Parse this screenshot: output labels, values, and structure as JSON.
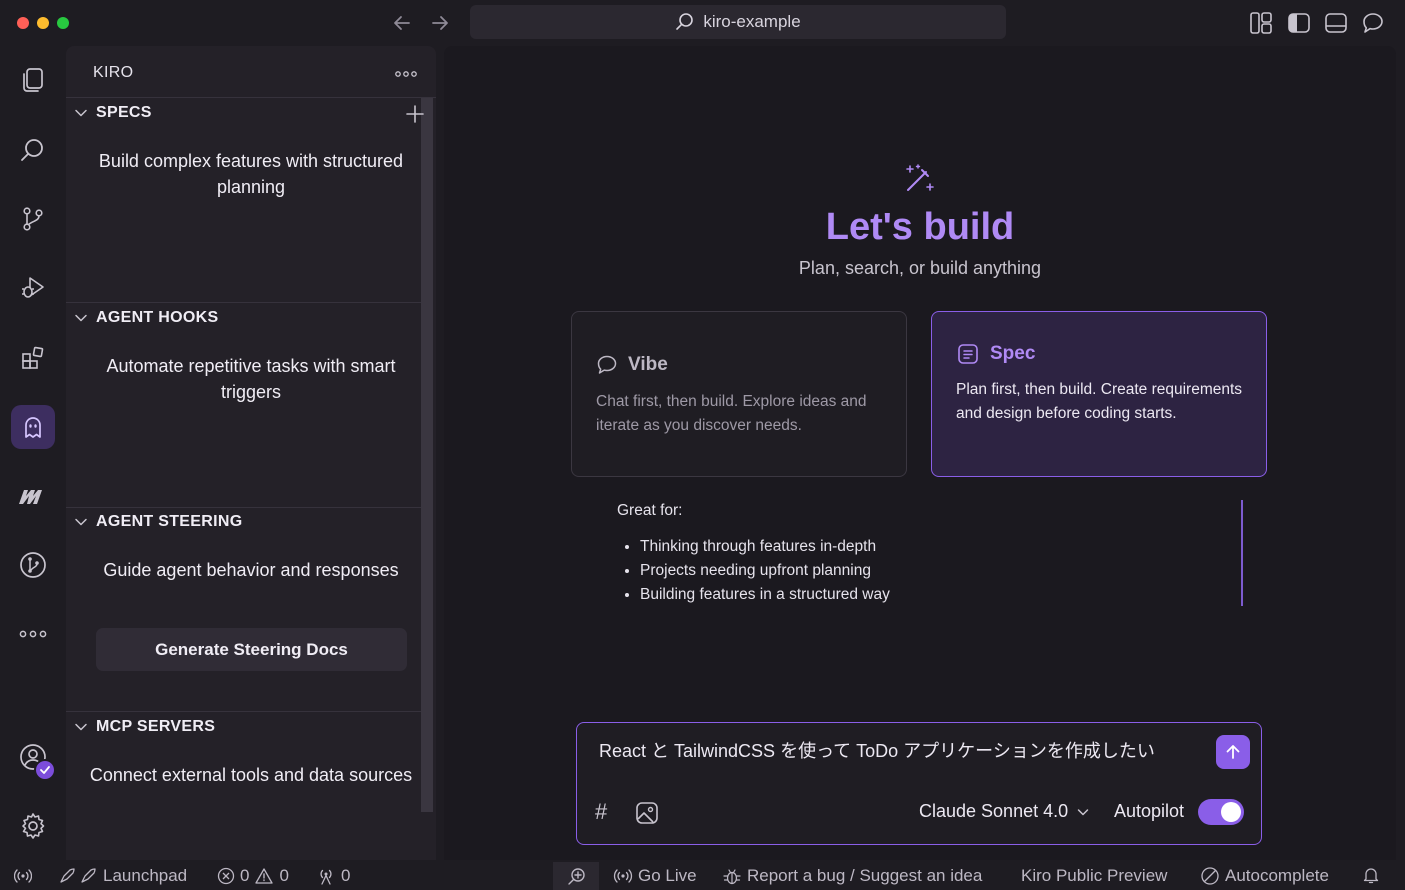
{
  "titlebar": {
    "search_text": "kiro-example"
  },
  "sidebar": {
    "title": "KIRO",
    "sections": [
      {
        "title": "SPECS",
        "description": "Build complex features with structured planning"
      },
      {
        "title": "AGENT HOOKS",
        "description": "Automate repetitive tasks with smart triggers"
      },
      {
        "title": "AGENT STEERING",
        "description": "Guide agent behavior and responses",
        "button": "Generate Steering Docs"
      },
      {
        "title": "MCP SERVERS",
        "description": "Connect external tools and data sources"
      }
    ]
  },
  "main": {
    "headline": "Let's build",
    "subheadline": "Plan, search, or build anything",
    "cards": {
      "vibe": {
        "title": "Vibe",
        "body": "Chat first, then build. Explore ideas and iterate as you discover needs."
      },
      "spec": {
        "title": "Spec",
        "body": "Plan first, then build. Create requirements and design before coding starts."
      }
    },
    "great_for": {
      "label": "Great for:",
      "items": [
        "Thinking through features in-depth",
        "Projects needing upfront planning",
        "Building features in a structured way"
      ]
    },
    "chat": {
      "input_value": "React と TailwindCSS を使って ToDo アプリケーションを作成したい",
      "hash_symbol": "#",
      "model": "Claude Sonnet 4.0",
      "autopilot_label": "Autopilot",
      "autopilot_on": true
    }
  },
  "statusbar": {
    "launchpad": "Launchpad",
    "errors": "0",
    "warnings": "0",
    "ports": "0",
    "go_live": "Go Live",
    "report": "Report a bug / Suggest an idea",
    "preview": "Kiro Public Preview",
    "autocomplete": "Autocomplete"
  },
  "colors": {
    "accent": "#8a5ee8",
    "headline": "#b08af5",
    "background": "#1b191f",
    "sidebar": "#242128"
  }
}
